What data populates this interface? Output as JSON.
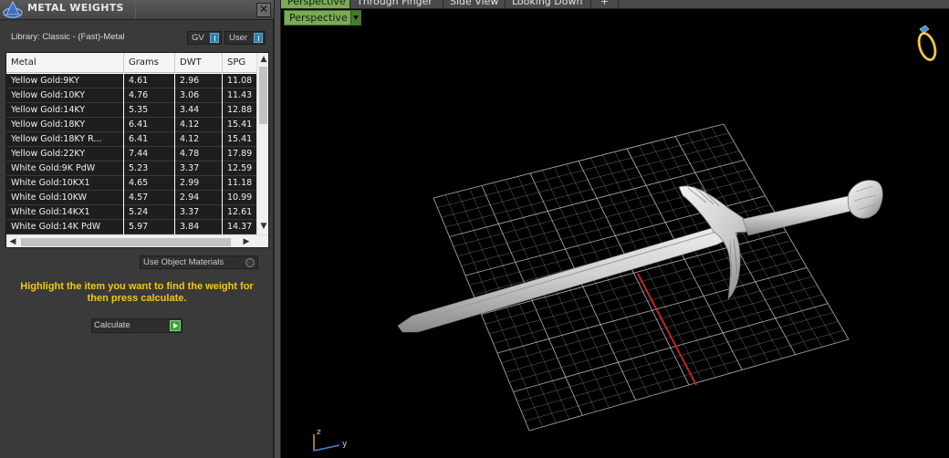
{
  "panel": {
    "title": "METAL WEIGHTS",
    "close_label": "✕",
    "library_label": "Library: Classic - (Fast)-Metal",
    "toggles": {
      "gv_label": "GV",
      "user_label": "User"
    },
    "use_object_materials_label": "Use Object Materials",
    "instruction": "Highlight the item you want to find the weight for then press calculate.",
    "calculate_label": "Calculate"
  },
  "table": {
    "columns": [
      "Metal",
      "Grams",
      "DWT",
      "SPG"
    ],
    "rows": [
      [
        "Yellow Gold:9KY",
        "4.61",
        "2.96",
        "11.08"
      ],
      [
        "Yellow Gold:10KY",
        "4.76",
        "3.06",
        "11.43"
      ],
      [
        "Yellow Gold:14KY",
        "5.35",
        "3.44",
        "12.88"
      ],
      [
        "Yellow Gold:18KY",
        "6.41",
        "4.12",
        "15.41"
      ],
      [
        "Yellow Gold:18KY R...",
        "6.41",
        "4.12",
        "15.41"
      ],
      [
        "Yellow Gold:22KY",
        "7.44",
        "4.78",
        "17.89"
      ],
      [
        "White Gold:9K PdW",
        "5.23",
        "3.37",
        "12.59"
      ],
      [
        "White Gold:10KX1",
        "4.65",
        "2.99",
        "11.18"
      ],
      [
        "White Gold:10KW",
        "4.57",
        "2.94",
        "10.99"
      ],
      [
        "White Gold:14KX1",
        "5.24",
        "3.37",
        "12.61"
      ],
      [
        "White Gold:14K PdW",
        "5.97",
        "3.84",
        "14.37"
      ]
    ]
  },
  "viewport": {
    "tabs": [
      "Perspective",
      "Through Finger",
      "Side View",
      "Looking Down",
      "+"
    ],
    "active_tab": "Perspective",
    "view_dropdown_label": "Perspective",
    "axis_z": "z",
    "axis_y": "y"
  },
  "colors": {
    "accent_green": "#7aaa55",
    "instruction_yellow": "#f5c518",
    "toggle_blue": "#2a7fb8",
    "grid": "#bdbdbd",
    "center_line": "#c0281e"
  }
}
